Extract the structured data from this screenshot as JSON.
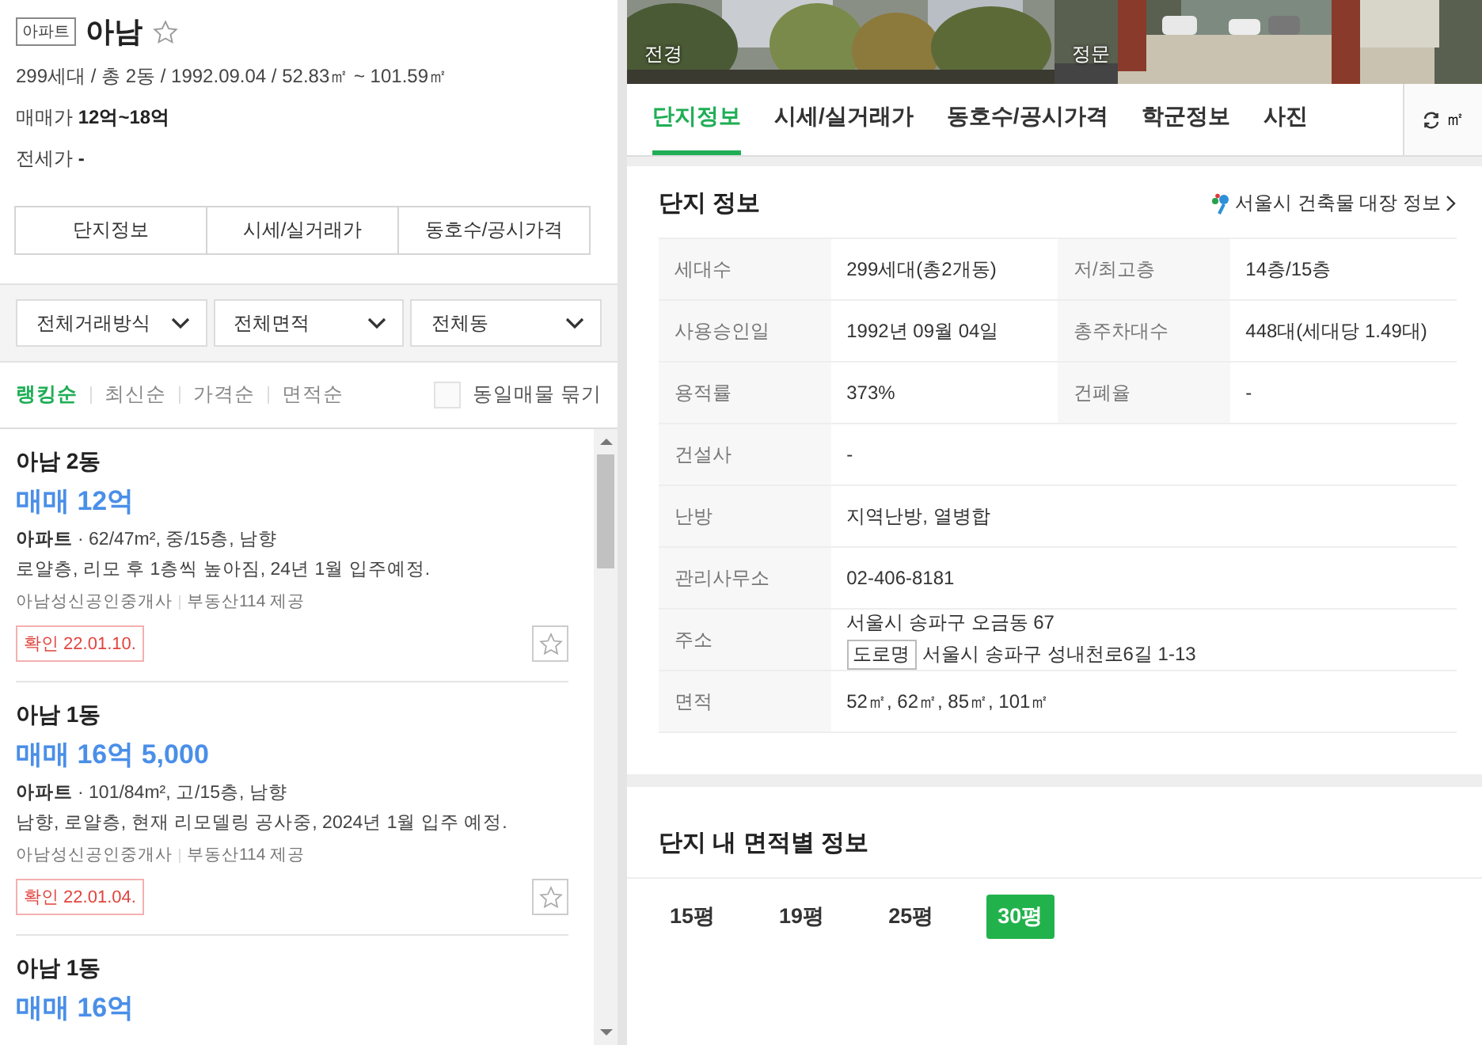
{
  "complex": {
    "type_tag": "아파트",
    "name": "아남",
    "summary": "299세대 / 총 2동 / 1992.09.04 / 52.83㎡ ~ 101.59㎡",
    "sale_price": "매매가 **12억~18억**",
    "jeonse_price": "전세가 **-**"
  },
  "header_buttons": [
    "단지정보",
    "시세/실거래가",
    "동호수/공시가격"
  ],
  "filters": [
    "전체거래방식",
    "전체면적",
    "전체동"
  ],
  "sort_options": [
    {
      "label": "랭킹순",
      "selected": true
    },
    {
      "label": "최신순",
      "selected": false
    },
    {
      "label": "가격순",
      "selected": false
    },
    {
      "label": "면적순",
      "selected": false
    }
  ],
  "group_listings": {
    "label": "동일매물 묶기",
    "checked": false
  },
  "listings": [
    {
      "title": "아남 2동",
      "price": "매매 12억",
      "type": "아파트",
      "specs": "· 62/47m², 중/15층, 남향",
      "description": "로얄층, 리모 후 1층씩 높아짐, 24년 1월 입주예정.",
      "agent": "아남성신공인중개사",
      "source": "부동산114 제공",
      "confirmed": "확인 22.01.10."
    },
    {
      "title": "아남 1동",
      "price": "매매 16억 5,000",
      "type": "아파트",
      "specs": "· 101/84m², 고/15층, 남향",
      "description": "남향, 로얄층, 현재 리모델링 공사중, 2024년 1월 입주 예정.",
      "agent": "아남성신공인중개사",
      "source": "부동산114 제공",
      "confirmed": "확인 22.01.04."
    },
    {
      "title": "아남 1동",
      "price": "매매 16억"
    }
  ],
  "photos": [
    {
      "kind": "trees",
      "label": "전경"
    },
    {
      "kind": "gate",
      "label": "정문"
    }
  ],
  "tabs": [
    {
      "label": "단지정보",
      "selected": true
    },
    {
      "label": "시세/실거래가",
      "selected": false
    },
    {
      "label": "동호수/공시가격",
      "selected": false
    },
    {
      "label": "학군정보",
      "selected": false
    },
    {
      "label": "사진",
      "selected": false
    }
  ],
  "unit_toggle": "㎡",
  "info": {
    "title": "단지 정보",
    "link": "서울시 건축물 대장 정보",
    "rows": [
      [
        {
          "label": "세대수",
          "value": "299세대(총2개동)"
        },
        {
          "label": "저/최고층",
          "value": "14층/15층"
        }
      ],
      [
        {
          "label": "사용승인일",
          "value": "1992년 09월 04일"
        },
        {
          "label": "총주차대수",
          "value": "448대(세대당 1.49대)"
        }
      ],
      [
        {
          "label": "용적률",
          "value": "373%"
        },
        {
          "label": "건폐율",
          "value": "-"
        }
      ],
      [
        {
          "label": "건설사",
          "value": "-"
        }
      ],
      [
        {
          "label": "난방",
          "value": "지역난방, 열병합"
        }
      ],
      [
        {
          "label": "관리사무소",
          "value": "02-406-8181"
        }
      ],
      [
        {
          "label": "주소",
          "value": "서울시 송파구 오금동 67",
          "extra": {
            "tag": "도로명",
            "text": "서울시 송파구 성내천로6길 1-13"
          }
        }
      ],
      [
        {
          "label": "면적",
          "value": "52㎡, 62㎡, 85㎡, 101㎡"
        }
      ]
    ]
  },
  "area_info": {
    "title": "단지 내 면적별 정보",
    "sizes": [
      {
        "label": "15평",
        "selected": false
      },
      {
        "label": "19평",
        "selected": false
      },
      {
        "label": "25평",
        "selected": false
      },
      {
        "label": "30평",
        "selected": true
      }
    ]
  }
}
